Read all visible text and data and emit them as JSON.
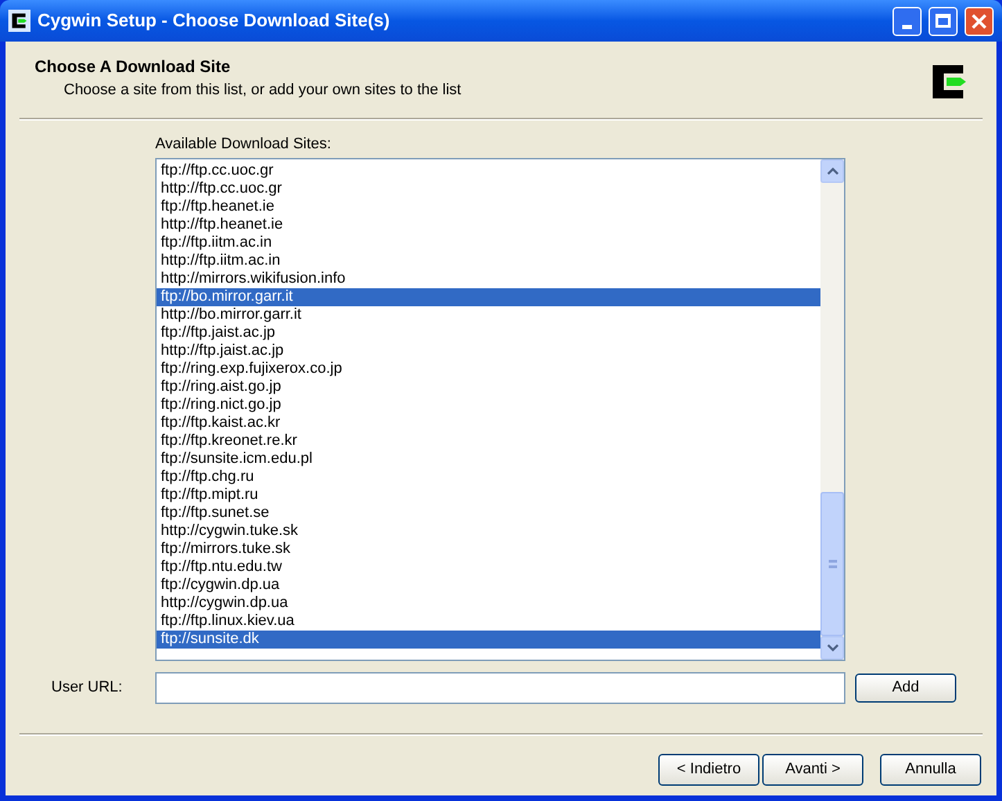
{
  "window": {
    "title": "Cygwin Setup - Choose Download Site(s)"
  },
  "header": {
    "title": "Choose A Download Site",
    "subtitle": "Choose a site from this list, or add your own sites to the list"
  },
  "site_list": {
    "label": "Available Download Sites:",
    "items": [
      {
        "text": "ftp://ftp.cc.uoc.gr",
        "selected": false
      },
      {
        "text": "http://ftp.cc.uoc.gr",
        "selected": false
      },
      {
        "text": "ftp://ftp.heanet.ie",
        "selected": false
      },
      {
        "text": "http://ftp.heanet.ie",
        "selected": false
      },
      {
        "text": "ftp://ftp.iitm.ac.in",
        "selected": false
      },
      {
        "text": "http://ftp.iitm.ac.in",
        "selected": false
      },
      {
        "text": "http://mirrors.wikifusion.info",
        "selected": false
      },
      {
        "text": "ftp://bo.mirror.garr.it",
        "selected": true
      },
      {
        "text": "http://bo.mirror.garr.it",
        "selected": false
      },
      {
        "text": "ftp://ftp.jaist.ac.jp",
        "selected": false
      },
      {
        "text": "http://ftp.jaist.ac.jp",
        "selected": false
      },
      {
        "text": "ftp://ring.exp.fujixerox.co.jp",
        "selected": false
      },
      {
        "text": "ftp://ring.aist.go.jp",
        "selected": false
      },
      {
        "text": "ftp://ring.nict.go.jp",
        "selected": false
      },
      {
        "text": "ftp://ftp.kaist.ac.kr",
        "selected": false
      },
      {
        "text": "ftp://ftp.kreonet.re.kr",
        "selected": false
      },
      {
        "text": "ftp://sunsite.icm.edu.pl",
        "selected": false
      },
      {
        "text": "ftp://ftp.chg.ru",
        "selected": false
      },
      {
        "text": "ftp://ftp.mipt.ru",
        "selected": false
      },
      {
        "text": "ftp://ftp.sunet.se",
        "selected": false
      },
      {
        "text": "http://cygwin.tuke.sk",
        "selected": false
      },
      {
        "text": "ftp://mirrors.tuke.sk",
        "selected": false
      },
      {
        "text": "ftp://ftp.ntu.edu.tw",
        "selected": false
      },
      {
        "text": "ftp://cygwin.dp.ua",
        "selected": false
      },
      {
        "text": "http://cygwin.dp.ua",
        "selected": false
      },
      {
        "text": "ftp://ftp.linux.kiev.ua",
        "selected": false
      },
      {
        "text": "ftp://sunsite.dk",
        "selected": true
      }
    ]
  },
  "user_url": {
    "label": "User URL:",
    "add_button": "Add"
  },
  "buttons": [
    "< Indietro",
    "Avanti >",
    "Annulla"
  ]
}
